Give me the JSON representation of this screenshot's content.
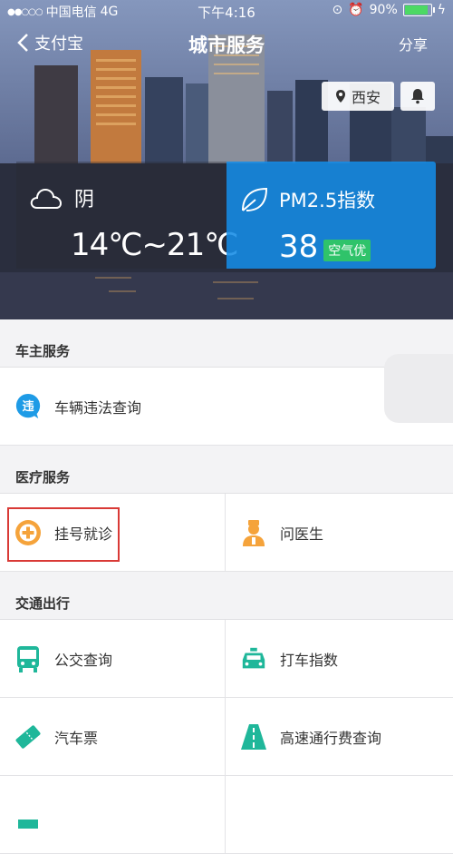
{
  "status_bar": {
    "carrier": "中国电信",
    "network": "4G",
    "time": "下午4:16",
    "battery": "90%",
    "battery_level": 0.9
  },
  "nav": {
    "back_label": "支付宝",
    "title": "城市服务",
    "share_label": "分享"
  },
  "location": "西安",
  "weather": {
    "condition": "阴",
    "temperature": "14℃~21℃"
  },
  "air": {
    "label": "PM2.5指数",
    "value": "38",
    "quality": "空气优"
  },
  "sections": [
    {
      "title": "车主服务",
      "items": [
        {
          "label": "车辆违法查询",
          "icon": "violation-icon",
          "icon_text": "违"
        }
      ]
    },
    {
      "title": "医疗服务",
      "items": [
        {
          "label": "挂号就诊",
          "icon": "medical-plus-icon"
        },
        {
          "label": "问医生",
          "icon": "doctor-icon"
        }
      ]
    },
    {
      "title": "交通出行",
      "items": [
        {
          "label": "公交查询",
          "icon": "bus-icon"
        },
        {
          "label": "打车指数",
          "icon": "taxi-icon"
        },
        {
          "label": "汽车票",
          "icon": "ticket-icon"
        },
        {
          "label": "高速通行费查询",
          "icon": "highway-icon"
        }
      ]
    }
  ],
  "colors": {
    "accent_blue": "#1e9be6",
    "accent_orange": "#f5a33b",
    "accent_teal": "#1fb79a",
    "highlight_red": "#d93a36",
    "aq_green": "#2fc36a"
  }
}
